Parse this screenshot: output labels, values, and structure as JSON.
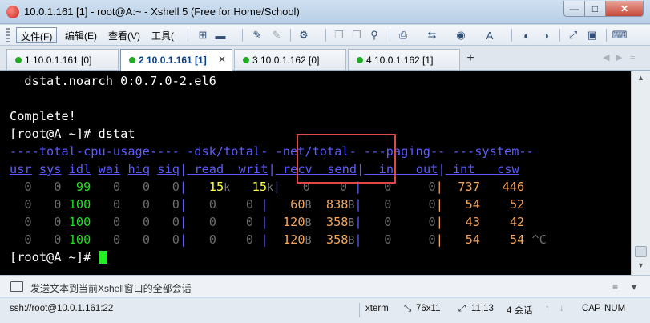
{
  "window": {
    "title": "10.0.1.161 [1] - root@A:~ - Xshell 5 (Free for Home/School)",
    "minimize": "—",
    "maximize": "□",
    "close": "✕"
  },
  "menu": [
    {
      "label": "文件(F)"
    },
    {
      "label": "编辑(E)"
    },
    {
      "label": "查看(V)"
    },
    {
      "label": "工具("
    }
  ],
  "toolbar_icons": [
    "new-session-icon",
    "open-folder-icon",
    "reconnect-icon",
    "disconnect-icon",
    "properties-icon",
    "copy-icon",
    "paste-icon",
    "find-icon",
    "print-icon",
    "transfer-icon",
    "globe-icon",
    "font-icon",
    "xftp-icon",
    "xmanager-icon",
    "fullscreen-icon",
    "lock-icon",
    "keyboard-icon"
  ],
  "tabs": [
    {
      "label": "1 10.0.1.161 [0]",
      "active": false
    },
    {
      "label": "2 10.0.1.161 [1]",
      "active": true
    },
    {
      "label": "3 10.0.1.162 [0]",
      "active": false
    },
    {
      "label": "4 10.0.1.162 [1]",
      "active": false
    }
  ],
  "tab_add": "+",
  "terminal": {
    "lines": [
      "  dstat.noarch 0:0.7.0-2.el6",
      "",
      "Complete!",
      "[root@A ~]# dstat"
    ],
    "group_header": "----total-cpu-usage---- -dsk/total- -net/total- ---paging-- ---system--",
    "columns": [
      "usr",
      "sys",
      "idl",
      "wai",
      "hiq",
      "siq",
      "read",
      "writ",
      "recv",
      "send",
      "in",
      "out",
      "int",
      "csw"
    ],
    "rows": [
      {
        "usr": "0",
        "sys": "0",
        "idl": "99",
        "wai": "0",
        "hiq": "0",
        "siq": "0",
        "read": "15",
        "read_unit": "k",
        "writ": "15",
        "writ_unit": "k",
        "recv": "0",
        "recv_unit": "",
        "send": "0",
        "send_unit": "",
        "in": "0",
        "out": "0",
        "int": "737",
        "csw": "446"
      },
      {
        "usr": "0",
        "sys": "0",
        "idl": "100",
        "wai": "0",
        "hiq": "0",
        "siq": "0",
        "read": "0",
        "read_unit": "",
        "writ": "0",
        "writ_unit": "",
        "recv": "60",
        "recv_unit": "B",
        "send": "838",
        "send_unit": "B",
        "in": "0",
        "out": "0",
        "int": "54",
        "csw": "52"
      },
      {
        "usr": "0",
        "sys": "0",
        "idl": "100",
        "wai": "0",
        "hiq": "0",
        "siq": "0",
        "read": "0",
        "read_unit": "",
        "writ": "0",
        "writ_unit": "",
        "recv": "120",
        "recv_unit": "B",
        "send": "358",
        "send_unit": "B",
        "in": "0",
        "out": "0",
        "int": "43",
        "csw": "42"
      },
      {
        "usr": "0",
        "sys": "0",
        "idl": "100",
        "wai": "0",
        "hiq": "0",
        "siq": "0",
        "read": "0",
        "read_unit": "",
        "writ": "0",
        "writ_unit": "",
        "recv": "120",
        "recv_unit": "B",
        "send": "358",
        "send_unit": "B",
        "in": "0",
        "out": "0",
        "int": "54",
        "csw": "54"
      }
    ],
    "interrupt": "^C",
    "prompt": "[root@A ~]# "
  },
  "compose": {
    "placeholder": "发送文本到当前Xshell窗口的全部会话"
  },
  "status": {
    "connection": "ssh://root@10.0.1.161:22",
    "terminal_type": "xterm",
    "size": "76x11",
    "cursor_pos": "11,13",
    "sessions": "4 会话",
    "caps": "CAP",
    "num": "NUM"
  },
  "colors": {
    "terminal_bg": "#000000",
    "header_blue": "#5b5bff",
    "idle_green": "#22dd22",
    "disk_yellow": "#ffff44",
    "net_orange": "#f5a55a",
    "highlight_red": "#e04848"
  }
}
